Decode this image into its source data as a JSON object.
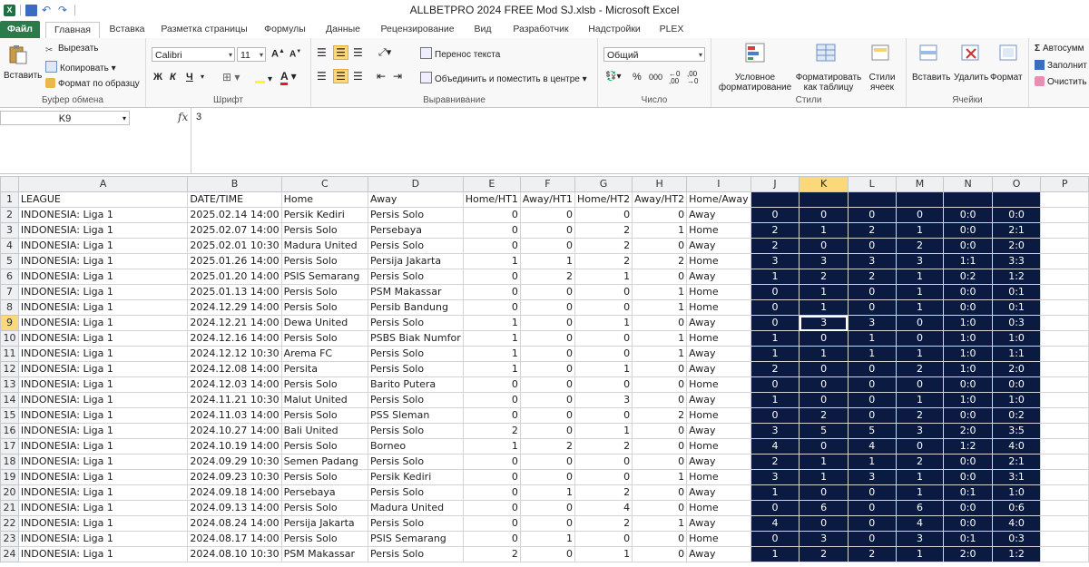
{
  "window": {
    "title": "ALLBETPRO 2024 FREE Mod SJ.xlsb  -  Microsoft Excel"
  },
  "tabs": [
    "Файл",
    "Главная",
    "Вставка",
    "Разметка страницы",
    "Формулы",
    "Данные",
    "Рецензирование",
    "Вид",
    "Разработчик",
    "Надстройки",
    "PLEX"
  ],
  "ribbon": {
    "clipboard": {
      "paste": "Вставить",
      "cut": "Вырезать",
      "copy": "Копировать",
      "format_painter": "Формат по образцу",
      "label": "Буфер обмена"
    },
    "font": {
      "name": "Calibri",
      "size": "11",
      "bold": "Ж",
      "italic": "К",
      "underline": "Ч",
      "label": "Шрифт"
    },
    "alignment": {
      "wrap": "Перенос текста",
      "merge": "Объединить и поместить в центре",
      "label": "Выравнивание"
    },
    "number": {
      "format": "Общий",
      "percent": "%",
      "thousands": "000",
      "label": "Число"
    },
    "styles": {
      "conditional": "Условное форматирование",
      "as_table": "Форматировать как таблицу",
      "cell_styles": "Стили ячеек",
      "label": "Стили"
    },
    "cells": {
      "insert": "Вставить",
      "delete": "Удалить",
      "format": "Формат",
      "label": "Ячейки"
    },
    "editing": {
      "autosum": "Автосумм",
      "fill": "Заполнит",
      "clear": "Очистить"
    }
  },
  "formula_bar": {
    "cell": "K9",
    "fx": "fx",
    "value": "3"
  },
  "columns": [
    "A",
    "B",
    "C",
    "D",
    "E",
    "F",
    "G",
    "H",
    "I",
    "J",
    "K",
    "L",
    "M",
    "N",
    "O",
    "P"
  ],
  "selected_column": "K",
  "selected_row": "9",
  "header_row": [
    "LEAGUE",
    "DATE/TIME",
    "Home",
    "Away",
    "Home/HT1",
    "Away/HT1",
    "Home/HT2",
    "Away/HT2",
    "Home/Away",
    "",
    "",
    "",
    "",
    "",
    "",
    ""
  ],
  "rows": [
    [
      "2",
      "INDONESIA: Liga 1",
      "2025.02.14 14:00",
      "Persik Kediri",
      "Persis Solo",
      "0",
      "0",
      "0",
      "0",
      "Away",
      "0",
      "0",
      "0",
      "0",
      "0:0",
      "0:0"
    ],
    [
      "3",
      "INDONESIA: Liga 1",
      "2025.02.07 14:00",
      "Persis Solo",
      "Persebaya",
      "0",
      "0",
      "2",
      "1",
      "Home",
      "2",
      "1",
      "2",
      "1",
      "0:0",
      "2:1"
    ],
    [
      "4",
      "INDONESIA: Liga 1",
      "2025.02.01 10:30",
      "Madura United",
      "Persis Solo",
      "0",
      "0",
      "2",
      "0",
      "Away",
      "2",
      "0",
      "0",
      "2",
      "0:0",
      "2:0"
    ],
    [
      "5",
      "INDONESIA: Liga 1",
      "2025.01.26 14:00",
      "Persis Solo",
      "Persija Jakarta",
      "1",
      "1",
      "2",
      "2",
      "Home",
      "3",
      "3",
      "3",
      "3",
      "1:1",
      "3:3"
    ],
    [
      "6",
      "INDONESIA: Liga 1",
      "2025.01.20 14:00",
      "PSIS Semarang",
      "Persis Solo",
      "0",
      "2",
      "1",
      "0",
      "Away",
      "1",
      "2",
      "2",
      "1",
      "0:2",
      "1:2"
    ],
    [
      "7",
      "INDONESIA: Liga 1",
      "2025.01.13 14:00",
      "Persis Solo",
      "PSM Makassar",
      "0",
      "0",
      "0",
      "1",
      "Home",
      "0",
      "1",
      "0",
      "1",
      "0:0",
      "0:1"
    ],
    [
      "8",
      "INDONESIA: Liga 1",
      "2024.12.29 14:00",
      "Persis Solo",
      "Persib Bandung",
      "0",
      "0",
      "0",
      "1",
      "Home",
      "0",
      "1",
      "0",
      "1",
      "0:0",
      "0:1"
    ],
    [
      "9",
      "INDONESIA: Liga 1",
      "2024.12.21 14:00",
      "Dewa United",
      "Persis Solo",
      "1",
      "0",
      "1",
      "0",
      "Away",
      "0",
      "3",
      "3",
      "0",
      "1:0",
      "0:3"
    ],
    [
      "10",
      "INDONESIA: Liga 1",
      "2024.12.16 14:00",
      "Persis Solo",
      "PSBS Biak Numfor",
      "1",
      "0",
      "0",
      "1",
      "Home",
      "1",
      "0",
      "1",
      "0",
      "1:0",
      "1:0"
    ],
    [
      "11",
      "INDONESIA: Liga 1",
      "2024.12.12 10:30",
      "Arema FC",
      "Persis Solo",
      "1",
      "0",
      "0",
      "1",
      "Away",
      "1",
      "1",
      "1",
      "1",
      "1:0",
      "1:1"
    ],
    [
      "12",
      "INDONESIA: Liga 1",
      "2024.12.08 14:00",
      "Persita",
      "Persis Solo",
      "1",
      "0",
      "1",
      "0",
      "Away",
      "2",
      "0",
      "0",
      "2",
      "1:0",
      "2:0"
    ],
    [
      "13",
      "INDONESIA: Liga 1",
      "2024.12.03 14:00",
      "Persis Solo",
      "Barito Putera",
      "0",
      "0",
      "0",
      "0",
      "Home",
      "0",
      "0",
      "0",
      "0",
      "0:0",
      "0:0"
    ],
    [
      "14",
      "INDONESIA: Liga 1",
      "2024.11.21 10:30",
      "Malut United",
      "Persis Solo",
      "0",
      "0",
      "3",
      "0",
      "Away",
      "1",
      "0",
      "0",
      "1",
      "1:0",
      "1:0"
    ],
    [
      "15",
      "INDONESIA: Liga 1",
      "2024.11.03 14:00",
      "Persis Solo",
      "PSS Sleman",
      "0",
      "0",
      "0",
      "2",
      "Home",
      "0",
      "2",
      "0",
      "2",
      "0:0",
      "0:2"
    ],
    [
      "16",
      "INDONESIA: Liga 1",
      "2024.10.27 14:00",
      "Bali United",
      "Persis Solo",
      "2",
      "0",
      "1",
      "0",
      "Away",
      "3",
      "5",
      "5",
      "3",
      "2:0",
      "3:5"
    ],
    [
      "17",
      "INDONESIA: Liga 1",
      "2024.10.19 14:00",
      "Persis Solo",
      "Borneo",
      "1",
      "2",
      "2",
      "0",
      "Home",
      "4",
      "0",
      "4",
      "0",
      "1:2",
      "4:0"
    ],
    [
      "18",
      "INDONESIA: Liga 1",
      "2024.09.29 10:30",
      "Semen Padang",
      "Persis Solo",
      "0",
      "0",
      "0",
      "0",
      "Away",
      "2",
      "1",
      "1",
      "2",
      "0:0",
      "2:1"
    ],
    [
      "19",
      "INDONESIA: Liga 1",
      "2024.09.23 10:30",
      "Persis Solo",
      "Persik Kediri",
      "0",
      "0",
      "0",
      "1",
      "Home",
      "3",
      "1",
      "3",
      "1",
      "0:0",
      "3:1"
    ],
    [
      "20",
      "INDONESIA: Liga 1",
      "2024.09.18 14:00",
      "Persebaya",
      "Persis Solo",
      "0",
      "1",
      "2",
      "0",
      "Away",
      "1",
      "0",
      "0",
      "1",
      "0:1",
      "1:0"
    ],
    [
      "21",
      "INDONESIA: Liga 1",
      "2024.09.13 14:00",
      "Persis Solo",
      "Madura United",
      "0",
      "0",
      "4",
      "0",
      "Home",
      "0",
      "6",
      "0",
      "6",
      "0:0",
      "0:6"
    ],
    [
      "22",
      "INDONESIA: Liga 1",
      "2024.08.24 14:00",
      "Persija Jakarta",
      "Persis Solo",
      "0",
      "0",
      "2",
      "1",
      "Away",
      "4",
      "0",
      "0",
      "4",
      "0:0",
      "4:0"
    ],
    [
      "23",
      "INDONESIA: Liga 1",
      "2024.08.17 14:00",
      "Persis Solo",
      "PSIS Semarang",
      "0",
      "1",
      "0",
      "0",
      "Home",
      "0",
      "3",
      "0",
      "3",
      "0:1",
      "0:3"
    ],
    [
      "24",
      "INDONESIA: Liga 1",
      "2024.08.10 10:30",
      "PSM Makassar",
      "Persis Solo",
      "2",
      "0",
      "1",
      "0",
      "Away",
      "1",
      "2",
      "2",
      "1",
      "2:0",
      "1:2"
    ]
  ],
  "colors": {
    "dark_fill": "#0a1a40",
    "selection": "#fbd97a",
    "file_tab": "#2a7a4a"
  }
}
